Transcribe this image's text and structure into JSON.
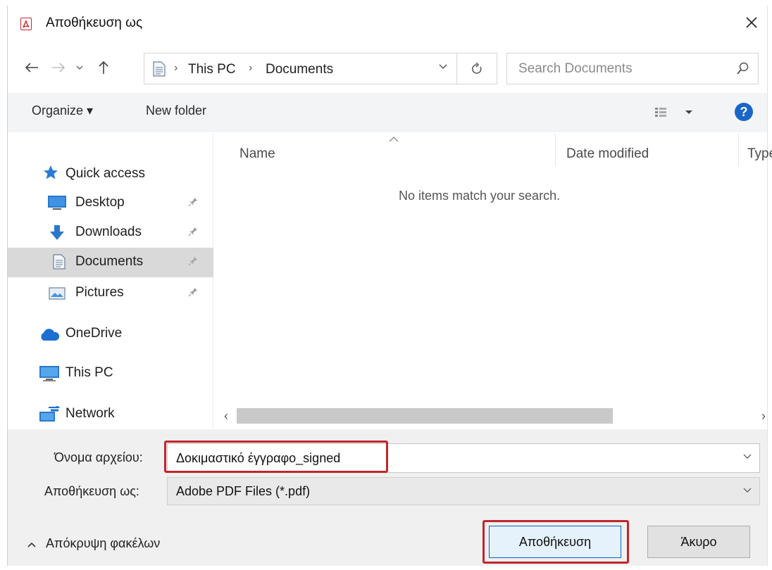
{
  "window": {
    "title": "Αποθήκευση ως"
  },
  "nav": {
    "breadcrumb": [
      "This PC",
      "Documents"
    ],
    "search_placeholder": "Search Documents"
  },
  "toolbar": {
    "organize_label": "Organize ▾",
    "new_folder_label": "New folder"
  },
  "sidebar": {
    "items": [
      {
        "label": "Quick access",
        "icon": "star-icon"
      },
      {
        "label": "Desktop",
        "icon": "desktop-icon",
        "pinned": true
      },
      {
        "label": "Downloads",
        "icon": "download-icon",
        "pinned": true
      },
      {
        "label": "Documents",
        "icon": "documents-icon",
        "pinned": true,
        "selected": true
      },
      {
        "label": "Pictures",
        "icon": "pictures-icon",
        "pinned": true
      },
      {
        "label": "OneDrive",
        "icon": "cloud-icon"
      },
      {
        "label": "This PC",
        "icon": "computer-icon"
      },
      {
        "label": "Network",
        "icon": "network-icon"
      }
    ]
  },
  "file_list": {
    "columns": [
      "Name",
      "Date modified",
      "Type"
    ],
    "empty_message": "No items match your search."
  },
  "form": {
    "filename_label": "Όνομα αρχείου:",
    "filename_value": "Δοκιμαστικό έγγραφο_signed",
    "savetype_label": "Αποθήκευση ως:",
    "savetype_value": "Adobe PDF Files (*.pdf)"
  },
  "footer": {
    "hide_folders_label": "Απόκρυψη φακέλων",
    "save_label": "Αποθήκευση",
    "cancel_label": "Άκυρο"
  },
  "colors": {
    "accent": "#0a63c9",
    "highlight": "#c0262c",
    "selected_bg": "#d9d9d9"
  }
}
